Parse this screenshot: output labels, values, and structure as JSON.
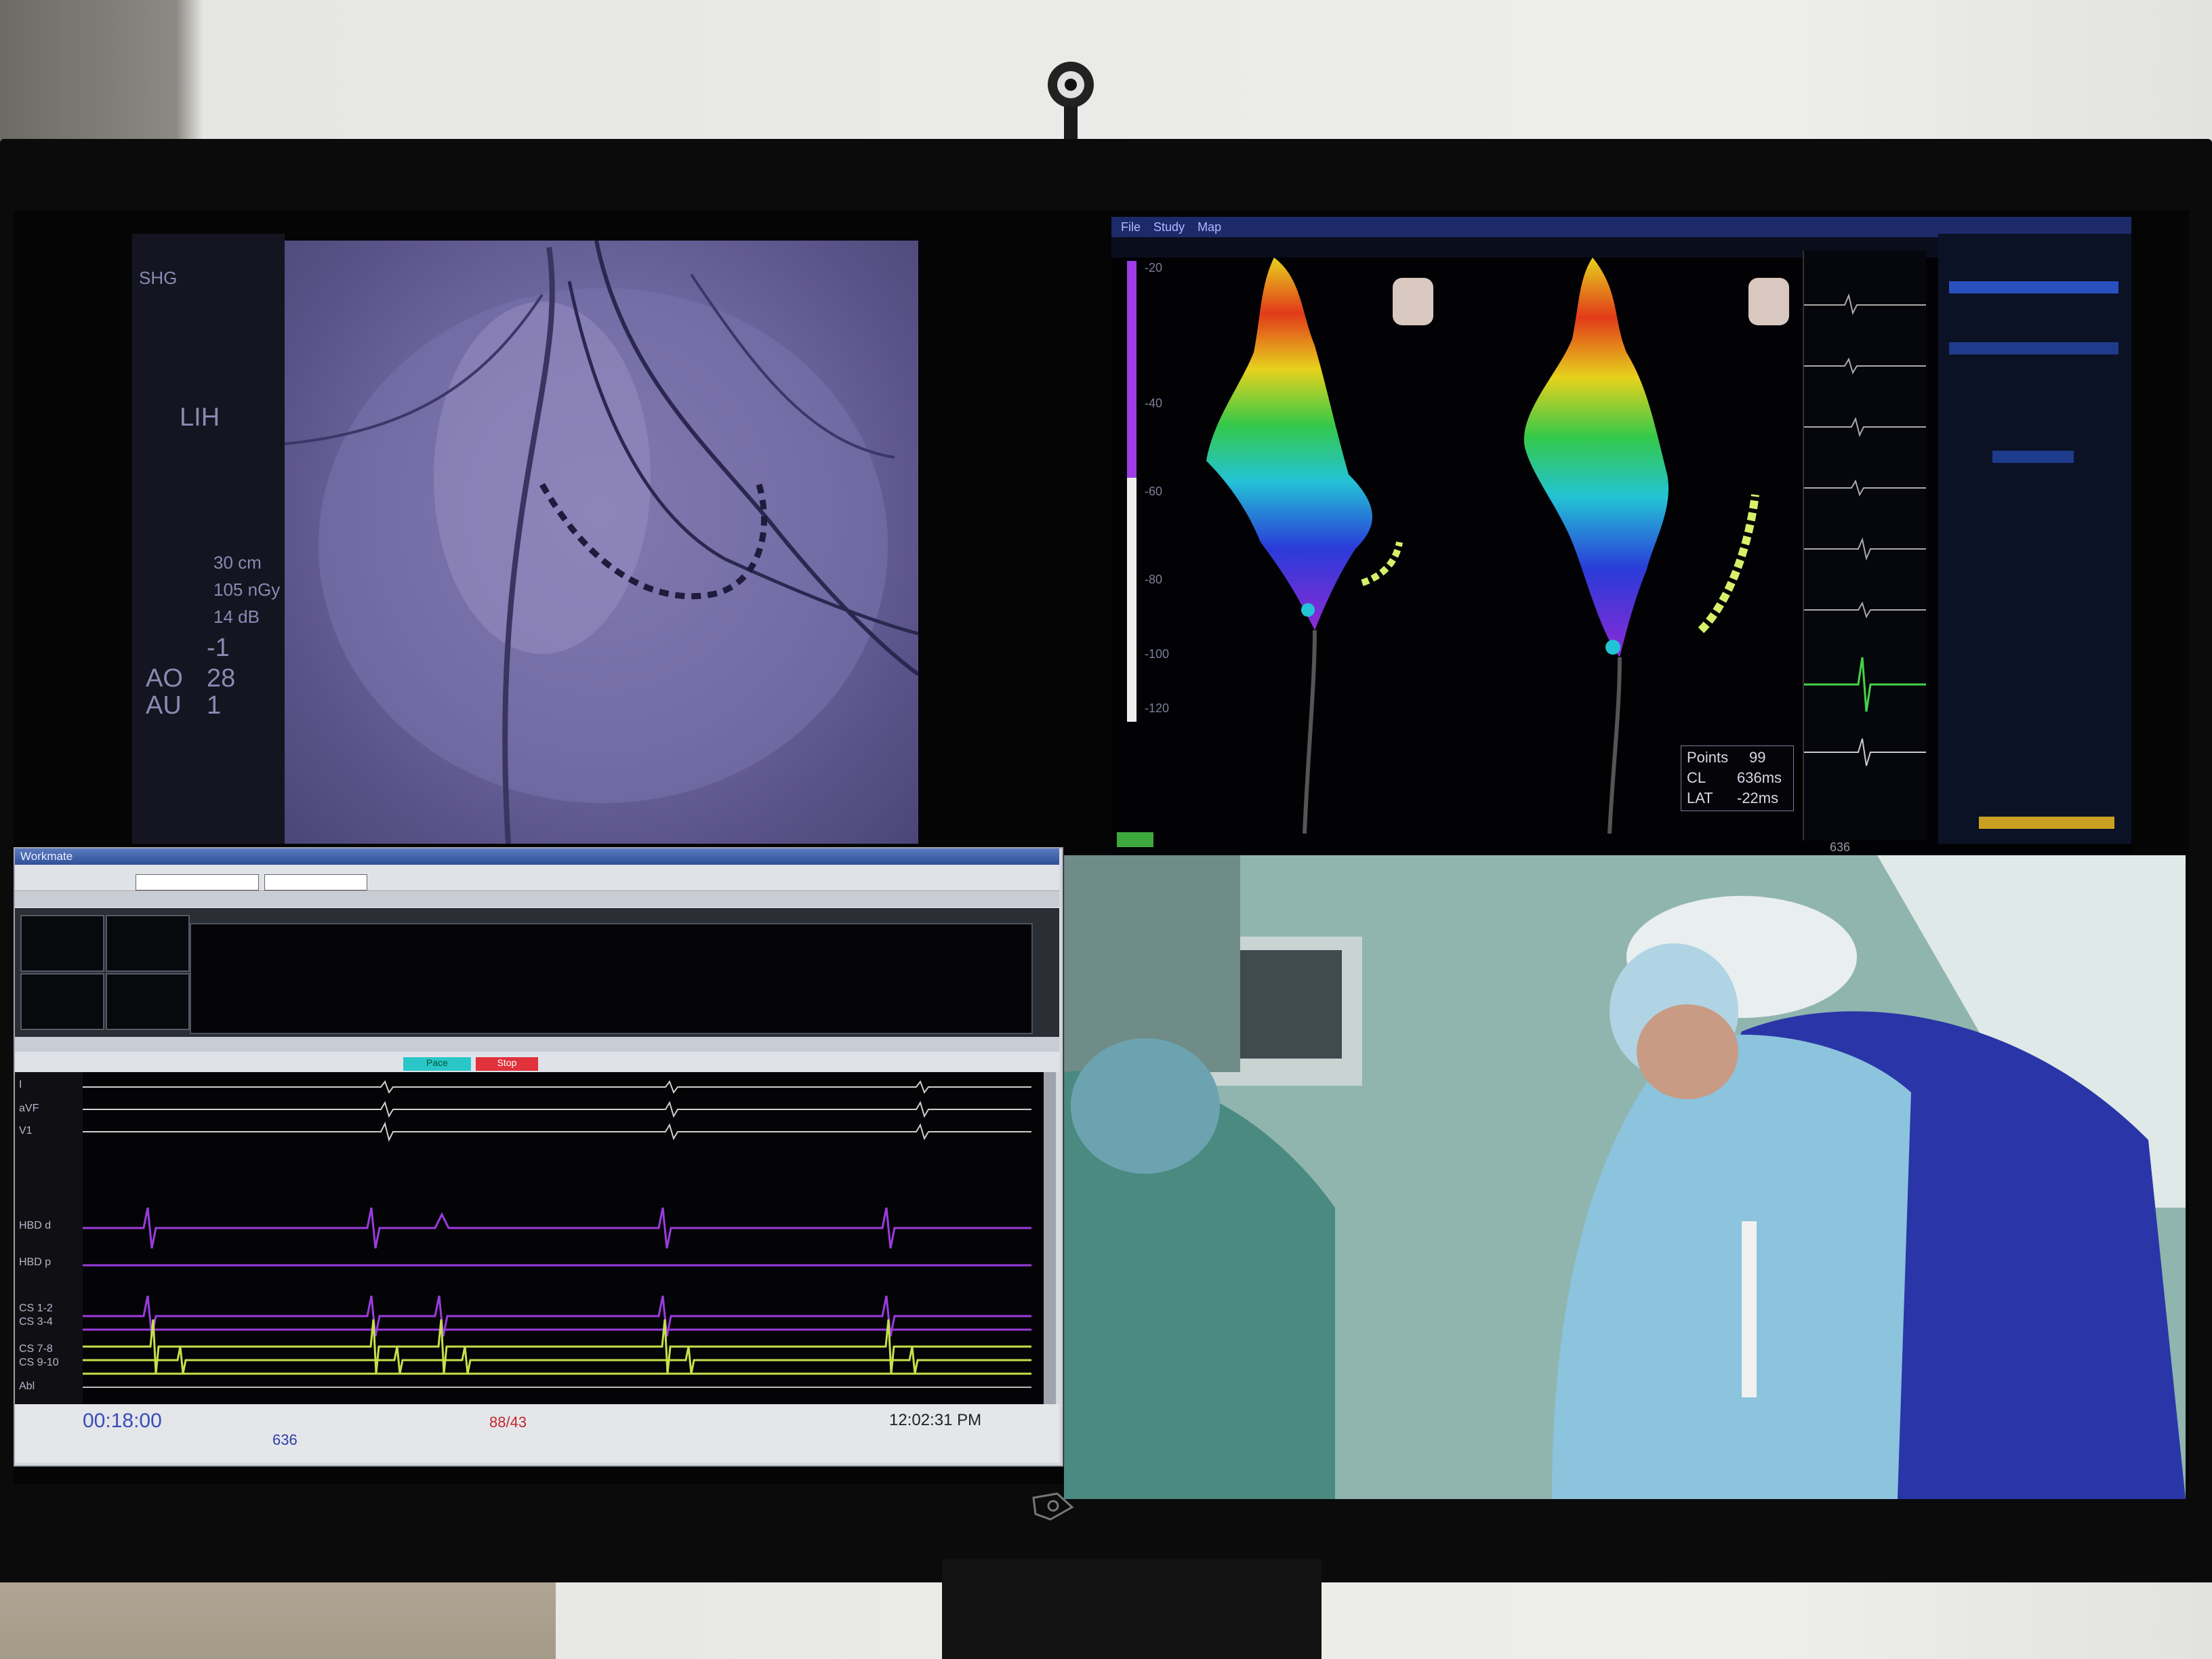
{
  "fluoroscopy": {
    "side_text": [
      "SHG",
      "LIH",
      "30 cm",
      "105 nGy",
      "14 dB"
    ],
    "angles": [
      {
        "label": "AO",
        "value": "28"
      },
      {
        "label": "AU",
        "value": "1"
      }
    ],
    "angle_top": "-1"
  },
  "mapping": {
    "menu": [
      "File",
      "Study",
      "Map"
    ],
    "scale_labels": [
      "-20",
      "-40",
      "-60",
      "-80",
      "-100",
      "-120"
    ],
    "readout": {
      "rows": [
        {
          "label": "Points",
          "value": "99"
        },
        {
          "label": "CL",
          "value": "636ms"
        },
        {
          "label": "LAT",
          "value": "-22ms"
        }
      ]
    },
    "status_cl": "636",
    "colors": {
      "red": "#e23a1a",
      "yellow": "#e6d21c",
      "green": "#34c84a",
      "cyan": "#23c3d6",
      "blue": "#2a3bd8",
      "purple": "#8d2ad6"
    }
  },
  "recording": {
    "title": "Workmate",
    "channels": [
      "I",
      "aVF",
      "V1",
      "HBD d",
      "HBD p",
      "CS 1-2",
      "CS 3-4",
      "CS 7-8",
      "CS 9-10",
      "Abl"
    ],
    "footer": {
      "time_display": "00:18:00",
      "cycle": "636",
      "pressure": "88/43",
      "clock": "12:02:31 PM"
    },
    "button_cyan": "Pace",
    "button_red": "Stop"
  }
}
